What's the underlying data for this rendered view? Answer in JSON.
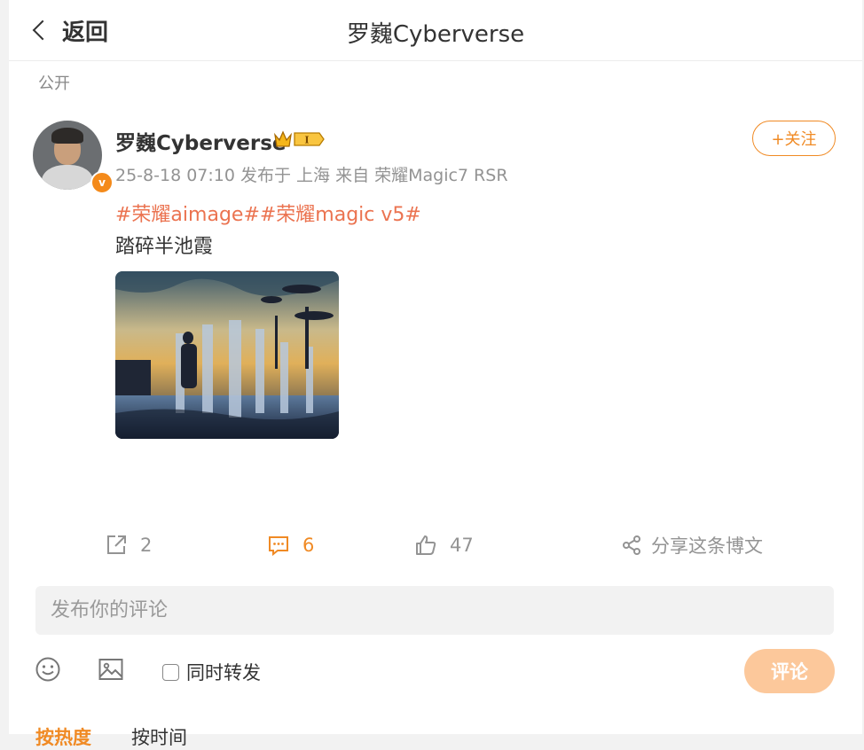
{
  "header": {
    "back_label": "返回",
    "title": "罗巍Cyberverse"
  },
  "post": {
    "visibility": "公开",
    "author": "罗巍Cyberverse",
    "follow_label": "+关注",
    "meta": "25-8-18 07:10  发布于 上海  来自 荣耀Magic7 RSR",
    "topics": [
      "#荣耀aimage#",
      "#荣耀magic v5#"
    ],
    "text": "踏碎半池霞",
    "badge_letter": "I",
    "verified_letter": "v"
  },
  "actions": {
    "repost_count": "2",
    "comment_count": "6",
    "like_count": "47",
    "share_label": "分享这条博文"
  },
  "comment": {
    "placeholder": "发布你的评论",
    "repost_label": "同时转发",
    "submit_label": "评论"
  },
  "sort_tabs": [
    "按热度",
    "按时间"
  ],
  "colors": {
    "accent": "#f08a24",
    "topic": "#eb7350",
    "muted": "#939393"
  }
}
